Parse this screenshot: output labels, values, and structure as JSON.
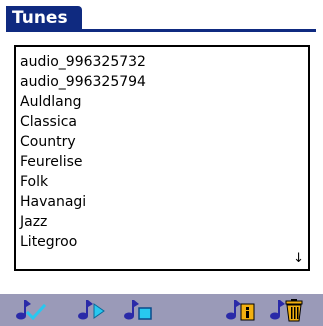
{
  "title": "Tunes",
  "list": {
    "items": [
      "audio_996325732",
      "audio_996325794",
      "Auldlang",
      "Classica",
      "Country",
      "Feurelise",
      "Folk",
      "Havanagi",
      "Jazz",
      "Litegroo"
    ],
    "scroll_down_glyph": "↓"
  },
  "toolbar": {
    "icons": [
      "tune-check-icon",
      "tune-play-icon",
      "tune-new-icon",
      "tune-info-icon",
      "tune-delete-icon"
    ]
  },
  "colors": {
    "title_bar": "#0f2a80",
    "toolbar": "#9a9ab8",
    "note_blue": "#2a2aa8",
    "accent_yellow": "#f2b010",
    "accent_cyan": "#28c8f0"
  }
}
